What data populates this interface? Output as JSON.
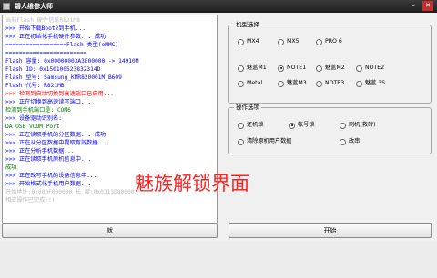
{
  "window": {
    "title": "碧人维修大师",
    "minimize": "–",
    "close": "✕"
  },
  "log": {
    "lines": [
      {
        "text": "当前Flash 硬件信息R821MB",
        "color": "#bbbbbb"
      },
      {
        "text": ">>> 开始下载Boot2到手机...",
        "color": "#0000ff"
      },
      {
        "text": ">>> 正在初始化手机硬件参数... 成功",
        "color": "#0000ff"
      },
      {
        "text": "    ==================Flash 类型(eMMC)",
        "color": "#0000ff"
      },
      {
        "text": "========================",
        "color": "#0000ff"
      },
      {
        "text": "    Flash 容量: 0x00000003A3E00000 -> 14910M",
        "color": "#0000ff"
      },
      {
        "text": "    Flash  ID: 0x150100523832314D",
        "color": "#0000ff"
      },
      {
        "text": "    Flash 型号: Samsung_KMR820001M_B609",
        "color": "#0000ff"
      },
      {
        "text": "    Flash 代号: R821MB",
        "color": "#0000ff"
      },
      {
        "text": ">>> 检测到自动切换到高速端口已启用...",
        "color": "#ff0000"
      },
      {
        "text": ">>> 正在切换到高速读写端口...",
        "color": "#0000ff"
      },
      {
        "text": "    检测到手机端口是: COM6",
        "color": "#008000"
      },
      {
        "text": ">>> 设备驱动识别名:",
        "color": "#0000ff"
      },
      {
        "text": "    DA USB VCOM Port",
        "color": "#008000"
      },
      {
        "text": ">>> 正在读取手机的分区数据... 成功",
        "color": "#0000ff"
      },
      {
        "text": ">>> 正在从分区数据中提取有效数据...",
        "color": "#0000ff"
      },
      {
        "text": ">>> 正在分析手机数据...",
        "color": "#0000ff"
      },
      {
        "text": ">>> 正在读取手机原机信息中...",
        "color": "#0000ff"
      },
      {
        "text": "成功",
        "color": "#008000"
      },
      {
        "text": ">>> 正在改写手机的设备信息中...",
        "color": "#0000ff"
      },
      {
        "text": ">>> 开始格式化手机用户数据...",
        "color": "#0000ff"
      },
      {
        "text": "    开始地址:0x000F000000    长    度:0x0313D80000",
        "color": "#bbbbbb"
      },
      {
        "text": "    相应操作已完成!!!",
        "color": "#bbbbbb"
      }
    ]
  },
  "watermark": "魅族解锁界面",
  "buttons": {
    "left_label": "就",
    "start_label": "开始"
  },
  "models_group": {
    "legend": "机型选择",
    "options": [
      "MX4",
      "MX5",
      "PRO 6",
      "魅蓝M1",
      "NOTE1",
      "魅蓝M2",
      "NOTE2",
      "Metal",
      "魅蓝M3",
      "NOTE3",
      "魅蓝 3S"
    ],
    "selected": "NOTE1"
  },
  "ops_group": {
    "legend": "操作选项",
    "options": [
      "还机锁",
      "帐号锁",
      "刷机(救砖)",
      "清除原机用户数据",
      "改串"
    ],
    "selected": "帐号锁"
  }
}
